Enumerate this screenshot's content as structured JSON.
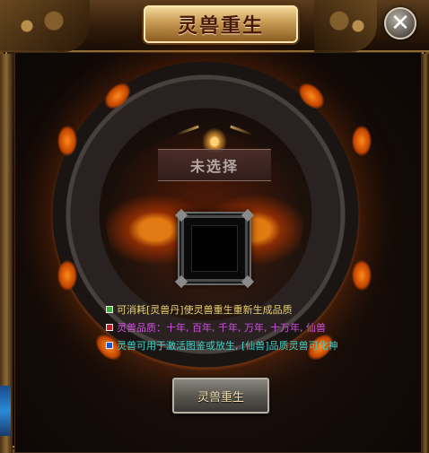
{
  "window": {
    "title": "灵兽重生",
    "close_label": "✕"
  },
  "selection": {
    "name": "未选择"
  },
  "info_lines": [
    {
      "text": "可消耗[灵兽丹]使灵兽重生重新生成品质",
      "color": "#e8d070",
      "bullet_color": "#3ab33a"
    },
    {
      "text": "灵兽品质：十年, 百年, 千年, 万年, 十万年, 仙兽",
      "color": "#d050e0",
      "bullet_color": "#c02020"
    },
    {
      "text": "灵兽可用于激活图鉴或放生, [仙兽]品质灵兽可化神",
      "color": "#40d0c8",
      "bullet_color": "#2050d0"
    }
  ],
  "action": {
    "label": "灵兽重生"
  },
  "colors": {
    "title_plate": "#c79a52",
    "frame_gold": "#a07a3e",
    "fire": "#ff8a1a"
  },
  "icons": {
    "close": "close-icon",
    "crest": "crest-icon",
    "bullet": "square-bullet-icon"
  }
}
